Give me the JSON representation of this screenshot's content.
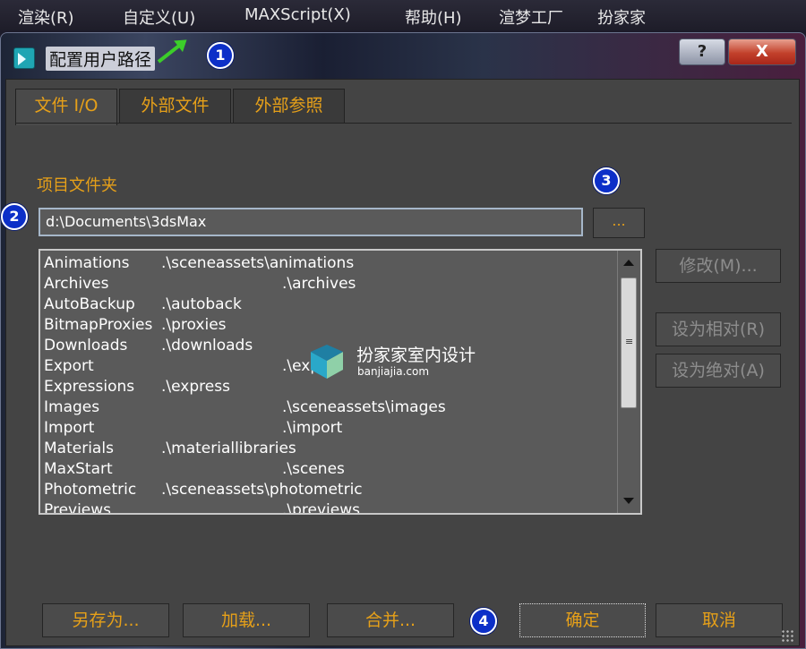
{
  "menubar": {
    "items": [
      "渲染(R)",
      "自定义(U)",
      "MAXScript(X)",
      "帮助(H)",
      "渲梦工厂",
      "扮家家"
    ]
  },
  "dialog": {
    "title": "配置用户路径",
    "help_label": "?",
    "close_label": "X",
    "badges": [
      "1",
      "2",
      "3",
      "4"
    ],
    "tabs": [
      "文件 I/O",
      "外部文件",
      "外部参照"
    ],
    "active_tab": 0,
    "section_label": "项目文件夹",
    "project_folder_value": "d:\\Documents\\3dsMax",
    "browse_label": "...",
    "paths": [
      {
        "name": "Animations",
        "path": ".\\sceneassets\\animations"
      },
      {
        "name": "Archives",
        "path": ".\\archives"
      },
      {
        "name": "AutoBackup",
        "path": ".\\autoback"
      },
      {
        "name": "BitmapProxies",
        "path": ".\\proxies"
      },
      {
        "name": "Downloads",
        "path": ".\\downloads"
      },
      {
        "name": "Export",
        "path": ".\\export"
      },
      {
        "name": "Expressions",
        "path": ".\\express"
      },
      {
        "name": "Images",
        "path": ".\\sceneassets\\images"
      },
      {
        "name": "Import",
        "path": ".\\import"
      },
      {
        "name": "Materials",
        "path": ".\\materiallibraries"
      },
      {
        "name": "MaxStart",
        "path": ".\\scenes"
      },
      {
        "name": "Photometric",
        "path": ".\\sceneassets\\photometric"
      },
      {
        "name": "Previews",
        "path": ".\\previews"
      }
    ],
    "side_buttons": {
      "modify": "修改(M)...",
      "make_relative": "设为相对(R)",
      "make_absolute": "设为绝对(A)"
    },
    "bottom_buttons": {
      "save_as": "另存为...",
      "load": "加载...",
      "merge": "合并...",
      "ok": "确定",
      "cancel": "取消"
    }
  },
  "watermark": {
    "title": "扮家家室内设计",
    "subtitle": "banjiajia.com"
  },
  "colors": {
    "accent_orange": "#e6a019",
    "badge_blue": "#0c2fc8",
    "arrow_green": "#3ccd2a",
    "panel_gray": "#444444"
  }
}
